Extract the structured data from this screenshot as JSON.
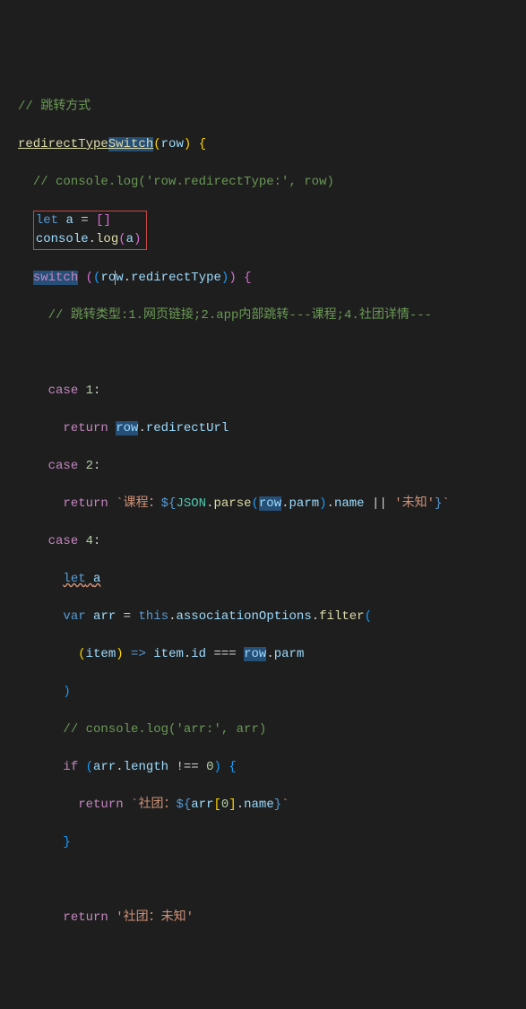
{
  "code": {
    "c1": "// 跳转方式",
    "fn": "redirectType",
    "fnSel": "Switch",
    "row": "row",
    "c2": "// console.log('row.redirectType:', row)",
    "let": "let",
    "a": "a",
    "eq": "=",
    "console": "console",
    "log": "log",
    "switch": "switch",
    "redirectType": "redirectType",
    "c3": "// 跳转类型:1.网页链接;2.app内部跳转---课程;4.社团详情---",
    "case": "case",
    "n1": "1",
    "n2": "2",
    "n4": "4",
    "n0": "0",
    "return": "return",
    "redirectUrl": "redirectUrl",
    "s2a": "`课程：",
    "dollar": "${",
    "JSON": "JSON",
    "parse": "parse",
    "parm": "parm",
    "name": "name",
    "or": "||",
    "unknown": "'未知'",
    "s2end": "}`",
    "leta": "let",
    "avar": "a",
    "var": "var",
    "arr": "arr",
    "this": "this",
    "assoc": "associationOptions",
    "filter": "filter",
    "item": "item",
    "arrow": "=>",
    "id": "id",
    "eqeq": "===",
    "c4": "// console.log('arr:', arr)",
    "if": "if",
    "length": "length",
    "neq": "!==",
    "s4a": "`社团：",
    "s5": "'社团：未知'"
  }
}
